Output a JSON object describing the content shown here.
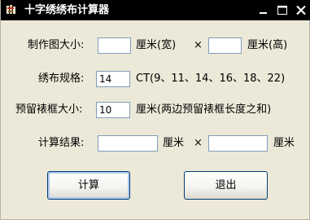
{
  "window": {
    "title": "十字绣绣布计算器"
  },
  "icons": {
    "app": "cross-stitch-app-icon",
    "minimize": "minimize-icon",
    "maximize": "maximize-icon",
    "close": "close-icon"
  },
  "colors": {
    "titlebar": "#000000",
    "window_bg": "#ece9d8",
    "field_border": "#7f9db9",
    "button_border": "#003c74"
  },
  "form": {
    "size_label": "制作图大小:",
    "width_value": "",
    "width_unit": "厘米(宽)",
    "times_1": "×",
    "height_value": "",
    "height_unit": "厘米(高)",
    "fabric_label": "绣布规格:",
    "fabric_value": "14",
    "fabric_hint": "CT(9、11、14、16、18、22)",
    "margin_label": "预留裱框大小:",
    "margin_value": "10",
    "margin_hint": "厘米(两边预留裱框长度之和)",
    "result_label": "计算结果:",
    "result_width": "",
    "result_width_unit": "厘米",
    "times_2": "×",
    "result_height": "",
    "result_height_unit": "厘米"
  },
  "buttons": {
    "calculate": "计算",
    "exit": "退出"
  }
}
